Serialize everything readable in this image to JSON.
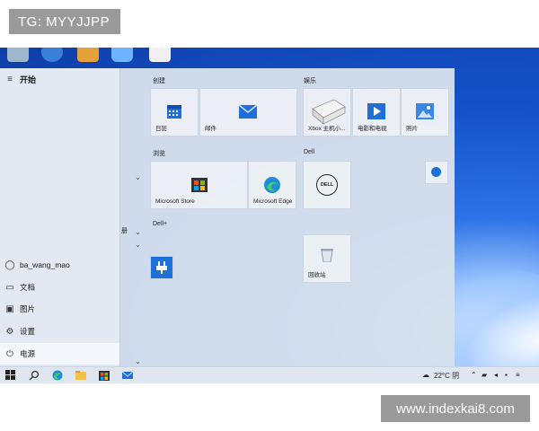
{
  "captions": {
    "top": "TG: MYYJJPP",
    "bottom": "www.indexkai8.com"
  },
  "start_menu": {
    "title": "开始",
    "user": "ba_wang_mao",
    "left_items": [
      {
        "label": "文档",
        "icon": "document-icon"
      },
      {
        "label": "图片",
        "icon": "picture-icon"
      },
      {
        "label": "设置",
        "icon": "gear-icon"
      },
      {
        "label": "电源",
        "icon": "power-icon"
      }
    ],
    "sections": {
      "create": "创建",
      "entertain": "娱乐",
      "browse": "浏览",
      "dell": "Dell",
      "dellplus": "Dell+"
    },
    "alpha_marker": "册",
    "tiles": {
      "calendar": "日历",
      "mail": "邮件",
      "xbox": "Xbox 主机小...",
      "movies": "电影和电视",
      "photos": "照片",
      "store": "Microsoft Store",
      "edge": "Microsoft Edge",
      "dell_logo": "DELL",
      "recycle": "回收站"
    }
  },
  "taskbar": {
    "weather": "22°C 阴",
    "icons": [
      "windows-start-icon",
      "search-icon",
      "edge-icon",
      "file-explorer-icon",
      "store-icon",
      "mail-icon"
    ]
  },
  "colors": {
    "accent": "#1e6fd6",
    "desktop": "#1452c9"
  }
}
